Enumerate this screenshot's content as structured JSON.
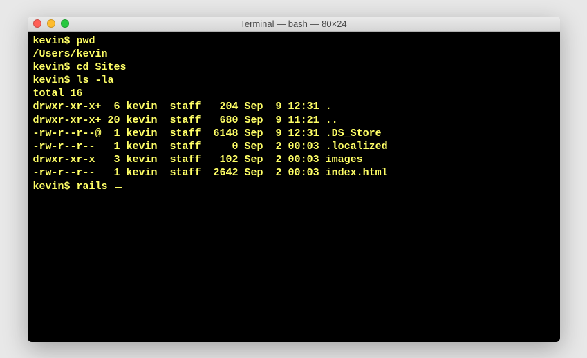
{
  "window": {
    "title": "Terminal — bash — 80×24"
  },
  "terminal": {
    "prompt": "kevin$",
    "lines": [
      {
        "prompt": "kevin$ ",
        "text": "pwd"
      },
      {
        "prompt": "",
        "text": "/Users/kevin"
      },
      {
        "prompt": "kevin$ ",
        "text": "cd Sites"
      },
      {
        "prompt": "kevin$ ",
        "text": "ls -la"
      },
      {
        "prompt": "",
        "text": "total 16"
      },
      {
        "prompt": "",
        "text": "drwxr-xr-x+  6 kevin  staff   204 Sep  9 12:31 ."
      },
      {
        "prompt": "",
        "text": "drwxr-xr-x+ 20 kevin  staff   680 Sep  9 11:21 .."
      },
      {
        "prompt": "",
        "text": "-rw-r--r--@  1 kevin  staff  6148 Sep  9 12:31 .DS_Store"
      },
      {
        "prompt": "",
        "text": "-rw-r--r--   1 kevin  staff     0 Sep  2 00:03 .localized"
      },
      {
        "prompt": "",
        "text": "drwxr-xr-x   3 kevin  staff   102 Sep  2 00:03 images"
      },
      {
        "prompt": "",
        "text": "-rw-r--r--   1 kevin  staff  2642 Sep  2 00:03 index.html"
      }
    ],
    "current_prompt": "kevin$ ",
    "current_input": "rails "
  }
}
